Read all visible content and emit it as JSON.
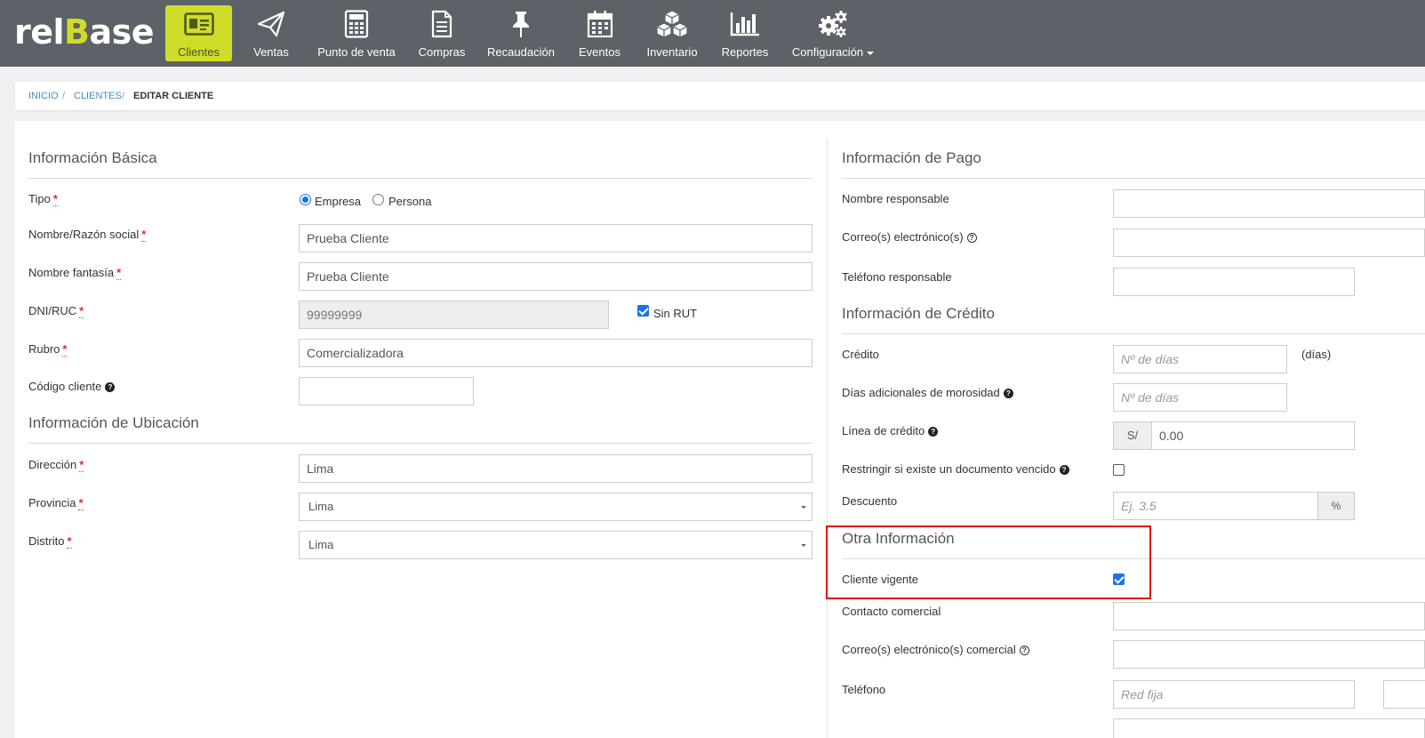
{
  "brand": {
    "logo_pre": "rel",
    "logo_b": "B",
    "logo_post": "ase"
  },
  "nav": [
    {
      "label": "Clientes",
      "icon": "id-card-icon",
      "active": true
    },
    {
      "label": "Ventas",
      "icon": "paper-plane-icon"
    },
    {
      "label": "Punto de venta",
      "icon": "calculator-icon"
    },
    {
      "label": "Compras",
      "icon": "document-icon"
    },
    {
      "label": "Recaudación",
      "icon": "pushpin-icon"
    },
    {
      "label": "Eventos",
      "icon": "calendar-icon"
    },
    {
      "label": "Inventario",
      "icon": "cubes-icon"
    },
    {
      "label": "Reportes",
      "icon": "bar-chart-icon"
    },
    {
      "label": "Configuración",
      "icon": "gears-icon"
    }
  ],
  "breadcrumb": {
    "home": "Inicio",
    "clients": "Clientes",
    "current": "Editar Cliente",
    "sep": "/"
  },
  "basic": {
    "title": "Información Básica",
    "tipo_label": "Tipo",
    "tipo_options": [
      "Empresa",
      "Persona"
    ],
    "tipo_selected": "Empresa",
    "razon_label": "Nombre/Razón social",
    "razon_value": "Prueba Cliente",
    "fantasia_label": "Nombre fantasía",
    "fantasia_value": "Prueba Cliente",
    "dni_label": "DNI/RUC",
    "dni_value": "99999999",
    "sin_rut_label": "Sin RUT",
    "sin_rut_checked": true,
    "rubro_label": "Rubro",
    "rubro_value": "Comercializadora",
    "codigo_label": "Código cliente",
    "codigo_value": "",
    "required_mark": "*",
    "help_mark": "?"
  },
  "location": {
    "title": "Información de Ubicación",
    "direccion_label": "Dirección",
    "direccion_value": "Lima",
    "provincia_label": "Provincia",
    "provincia_value": "Lima",
    "distrito_label": "Distrito",
    "distrito_value": "Lima"
  },
  "payment": {
    "title": "Información de Pago",
    "responsable_label": "Nombre responsable",
    "correo_label": "Correo(s) electrónico(s)",
    "telefono_label": "Teléfono responsable"
  },
  "credit": {
    "title": "Información de Crédito",
    "credito_label": "Crédito",
    "credito_placeholder": "Nº de días",
    "credito_unit": "(días)",
    "dias_label": "Días adicionales de morosidad",
    "dias_placeholder": "Nº de días",
    "linea_label": "Línea de crédito",
    "linea_currency": "S/",
    "linea_value": "0.00",
    "restringir_label": "Restringir si existe un documento vencido",
    "restringir_checked": false,
    "descuento_label": "Descuento",
    "descuento_placeholder": "Ej. 3.5",
    "descuento_unit": "%"
  },
  "other": {
    "title": "Otra Información",
    "vigente_label": "Cliente vigente",
    "vigente_checked": true,
    "contacto_label": "Contacto comercial",
    "correo_comercial_label": "Correo(s) electrónico(s) comercial",
    "telefono_label": "Teléfono",
    "telefono_placeholder": "Red fija"
  },
  "colors": {
    "nav_bg": "#5c6268",
    "accent": "#cfdc2a",
    "link": "#3a8fc8",
    "required": "#d9332b",
    "highlight": "#e0101a",
    "checkbox": "#1a73e8"
  }
}
